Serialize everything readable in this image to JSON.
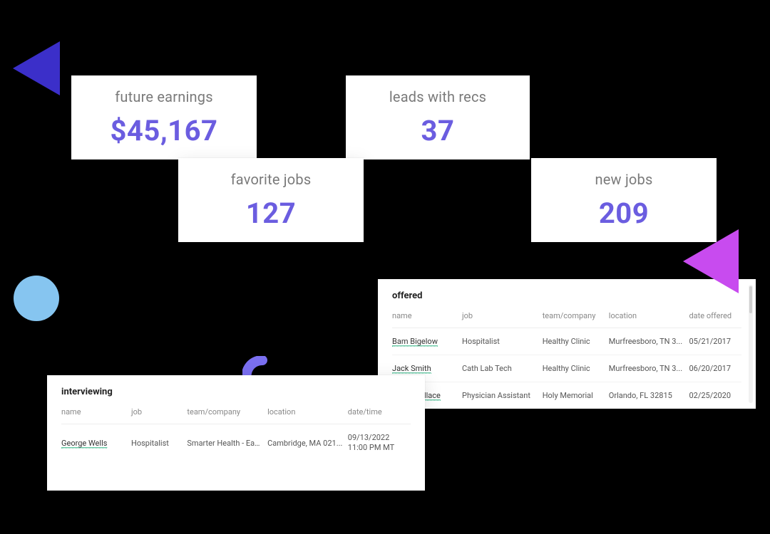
{
  "stats": {
    "future_earnings": {
      "label": "future earnings",
      "value": "$45,167"
    },
    "leads_with_recs": {
      "label": "leads with recs",
      "value": "37"
    },
    "favorite_jobs": {
      "label": "favorite jobs",
      "value": "127"
    },
    "new_jobs": {
      "label": "new jobs",
      "value": "209"
    }
  },
  "offered": {
    "title": "offered",
    "headers": {
      "name": "name",
      "job": "job",
      "team": "team/company",
      "location": "location",
      "date": "date offered"
    },
    "rows": [
      {
        "name": "Bam Bigelow",
        "job": "Hospitalist",
        "team": "Healthy Clinic",
        "location": "Murfreesboro, TN 3...",
        "date": "05/21/2017"
      },
      {
        "name": "Jack Smith",
        "job": "Cath Lab Tech",
        "team": "Healthy Clinic",
        "location": "Murfreesboro, TN 3...",
        "date": "06/20/2017"
      },
      {
        "name": "Leigh Wallace",
        "job": "Physician Assistant",
        "team": "Holy Memorial",
        "location": "Orlando, FL 32815",
        "date": "02/25/2020"
      }
    ]
  },
  "interviewing": {
    "title": "interviewing",
    "headers": {
      "name": "name",
      "job": "job",
      "team": "team/company",
      "location": "location",
      "datetime": "date/time"
    },
    "rows": [
      {
        "name": "George Wells",
        "job": "Hospitalist",
        "team": "Smarter Health - Eas...",
        "location": "Cambridge, MA 021...",
        "date": "09/13/2022",
        "time": "11:00 PM MT"
      }
    ]
  }
}
